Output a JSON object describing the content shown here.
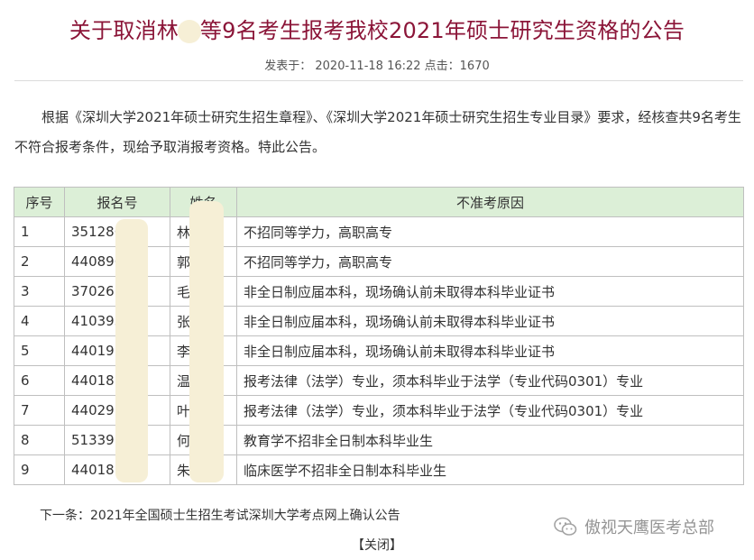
{
  "header": {
    "title_before": "关于取消林",
    "title_after": "等9名考生报考我校2021年硕士研究生资格的公告",
    "meta": "发表于： 2020-11-18 16:22 点击：1670"
  },
  "body": {
    "paragraph": "根据《深圳大学2021年硕士研究生招生章程》、《深圳大学2021年硕士研究生招生专业目录》要求，经核查共9名考生不符合报考条件，现给予取消报考资格。特此公告。"
  },
  "table": {
    "headers": [
      "序号",
      "报名号",
      "姓名",
      "不准考原因"
    ],
    "rows": [
      {
        "no": "1",
        "id": "351286",
        "name": "林",
        "reason": "不招同等学力，高职高专"
      },
      {
        "no": "2",
        "id": "440896",
        "name": "郭",
        "reason": "不招同等学力，高职高专"
      },
      {
        "no": "3",
        "id": "370261",
        "name": "毛",
        "reason": "非全日制应届本科，现场确认前未取得本科毕业证书"
      },
      {
        "no": "4",
        "id": "410393",
        "name": "张",
        "reason": "非全日制应届本科，现场确认前未取得本科毕业证书"
      },
      {
        "no": "5",
        "id": "44019",
        "name": "李",
        "reason": "非全日制应届本科，现场确认前未取得本科毕业证书"
      },
      {
        "no": "6",
        "id": "44018",
        "name": "温",
        "reason": "报考法律（法学）专业，须本科毕业于法学（专业代码0301）专业"
      },
      {
        "no": "7",
        "id": "44029",
        "name": "叶",
        "reason": "报考法律（法学）专业，须本科毕业于法学（专业代码0301）专业"
      },
      {
        "no": "8",
        "id": "51339",
        "name": "何",
        "reason": "教育学不招非全日制本科毕业生"
      },
      {
        "no": "9",
        "id": "44018",
        "name": "朱",
        "reason": "临床医学不招非全日制本科毕业生"
      }
    ]
  },
  "footer": {
    "next_link": "下一条：2021年全国硕士生招生考试深圳大学考点网上确认公告",
    "close_label": "【关闭】"
  },
  "watermark": {
    "text": "傲视天鹰医考总部",
    "icon": "wechat-icon"
  },
  "colors": {
    "title": "#8b1538",
    "table_header_bg": "#dcefd7",
    "redaction": "#f6efd6"
  }
}
